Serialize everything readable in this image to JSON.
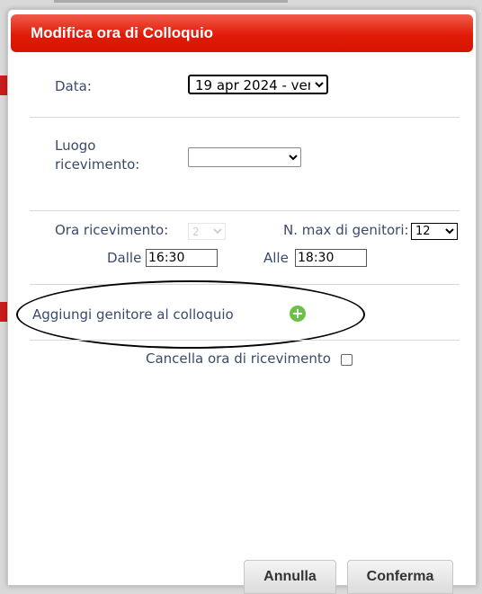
{
  "dialog": {
    "title": "Modifica ora di Colloquio",
    "data_label": "Data:",
    "data_value": "19 apr 2024 - ven",
    "luogo_label": "Luogo\nricevimento:",
    "luogo_value": "",
    "ora_label": "Ora ricevimento:",
    "ora_value": "2",
    "nmax_label": "N. max di genitori:",
    "nmax_value": "12",
    "dalle_label": "Dalle",
    "dalle_value": "16:30",
    "alle_label": "Alle",
    "alle_value": "18:30",
    "add_parent_label": "Aggiungi genitore al colloquio",
    "cancel_hour_label": "Cancella ora di ricevimento",
    "annulla_label": "Annulla",
    "conferma_label": "Conferma"
  },
  "colors": {
    "title_bar": "#e01b08",
    "label_text": "#3a4a6b",
    "add_icon": "#6cc04a"
  },
  "icons": {
    "add": "plus-circle-icon",
    "dropdown": "chevron-down-icon"
  }
}
